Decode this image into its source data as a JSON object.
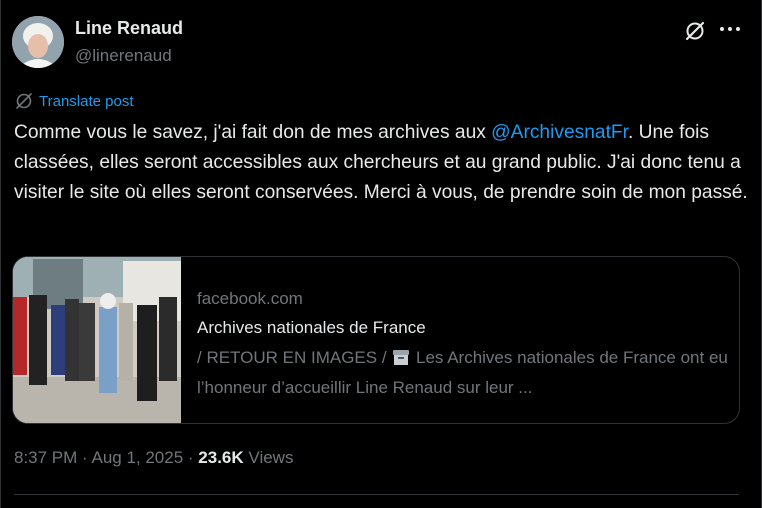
{
  "author": {
    "name": "Line Renaud",
    "handle": "@linerenaud"
  },
  "translate_label": "Translate post",
  "post": {
    "text_before": "Comme vous le savez, j'ai fait don de mes archives aux ",
    "mention": "@ArchivesnatFr",
    "text_after": ". Une fois classées, elles seront accessibles aux chercheurs et au grand public. J'ai donc tenu a visiter le site où elles seront conservées. Merci à vous, de prendre soin de mon passé."
  },
  "link_card": {
    "domain": "facebook.com",
    "title": "Archives nationales de France",
    "description_prefix": "/ RETOUR EN IMAGES / ",
    "description": " Les Archives nationales de France ont eu l’honneur d’accueillir Line Renaud sur leur ..."
  },
  "meta": {
    "time": "8:37 PM",
    "date": "Aug 1, 2025",
    "views_count": "23.6K",
    "views_label": "Views",
    "separator": " · "
  },
  "icons": {
    "grok": "grok-icon",
    "more": "more-icon",
    "translate": "translate-icon",
    "archive": "archive-box-icon"
  },
  "colors": {
    "background": "#000000",
    "text": "#e7e9ea",
    "muted": "#71767b",
    "accent": "#1d9bf0",
    "border": "#2f3336"
  }
}
